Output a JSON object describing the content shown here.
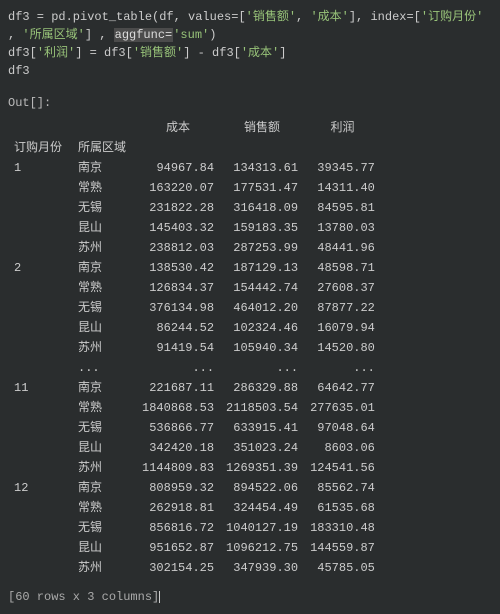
{
  "code": {
    "line1": {
      "a": "df3 = pd.pivot_table(df, values=[",
      "s1": "'销售额'",
      "c1": ", ",
      "s2": "'成本'",
      "c2": "], index=[",
      "s3": "'订购月份'"
    },
    "line2": {
      "a": ", ",
      "s1": "'所属区域'",
      "c1": "] , ",
      "sel": "aggfunc=",
      "s2": "'sum'",
      "c2": ")"
    },
    "line3": {
      "a": "df3[",
      "s1": "'利润'",
      "b": "] = df3[",
      "s2": "'销售额'",
      "c": "] - df3[",
      "s3": "'成本'",
      "d": "]"
    },
    "line4": "df3"
  },
  "out_label": "Out[]:",
  "headers": {
    "idx1": "订购月份",
    "idx2": "所属区域",
    "c1": "成本",
    "c2": "销售额",
    "c3": "利润"
  },
  "ellipsis": "...",
  "shape": "[60 rows x 3 columns]",
  "rows": [
    {
      "m": "1",
      "r": "南京",
      "v": [
        "94967.84",
        "134313.61",
        "39345.77"
      ]
    },
    {
      "m": "",
      "r": "常熟",
      "v": [
        "163220.07",
        "177531.47",
        "14311.40"
      ]
    },
    {
      "m": "",
      "r": "无锡",
      "v": [
        "231822.28",
        "316418.09",
        "84595.81"
      ]
    },
    {
      "m": "",
      "r": "昆山",
      "v": [
        "145403.32",
        "159183.35",
        "13780.03"
      ]
    },
    {
      "m": "",
      "r": "苏州",
      "v": [
        "238812.03",
        "287253.99",
        "48441.96"
      ]
    },
    {
      "m": "2",
      "r": "南京",
      "v": [
        "138530.42",
        "187129.13",
        "48598.71"
      ]
    },
    {
      "m": "",
      "r": "常熟",
      "v": [
        "126834.37",
        "154442.74",
        "27608.37"
      ]
    },
    {
      "m": "",
      "r": "无锡",
      "v": [
        "376134.98",
        "464012.20",
        "87877.22"
      ]
    },
    {
      "m": "",
      "r": "昆山",
      "v": [
        "86244.52",
        "102324.46",
        "16079.94"
      ]
    },
    {
      "m": "",
      "r": "苏州",
      "v": [
        "91419.54",
        "105940.34",
        "14520.80"
      ]
    }
  ],
  "rows2": [
    {
      "m": "11",
      "r": "南京",
      "v": [
        "221687.11",
        "286329.88",
        "64642.77"
      ]
    },
    {
      "m": "",
      "r": "常熟",
      "v": [
        "1840868.53",
        "2118503.54",
        "277635.01"
      ]
    },
    {
      "m": "",
      "r": "无锡",
      "v": [
        "536866.77",
        "633915.41",
        "97048.64"
      ]
    },
    {
      "m": "",
      "r": "昆山",
      "v": [
        "342420.18",
        "351023.24",
        "8603.06"
      ]
    },
    {
      "m": "",
      "r": "苏州",
      "v": [
        "1144809.83",
        "1269351.39",
        "124541.56"
      ]
    },
    {
      "m": "12",
      "r": "南京",
      "v": [
        "808959.32",
        "894522.06",
        "85562.74"
      ]
    },
    {
      "m": "",
      "r": "常熟",
      "v": [
        "262918.81",
        "324454.49",
        "61535.68"
      ]
    },
    {
      "m": "",
      "r": "无锡",
      "v": [
        "856816.72",
        "1040127.19",
        "183310.48"
      ]
    },
    {
      "m": "",
      "r": "昆山",
      "v": [
        "951652.87",
        "1096212.75",
        "144559.87"
      ]
    },
    {
      "m": "",
      "r": "苏州",
      "v": [
        "302154.25",
        "347939.30",
        "45785.05"
      ]
    }
  ]
}
